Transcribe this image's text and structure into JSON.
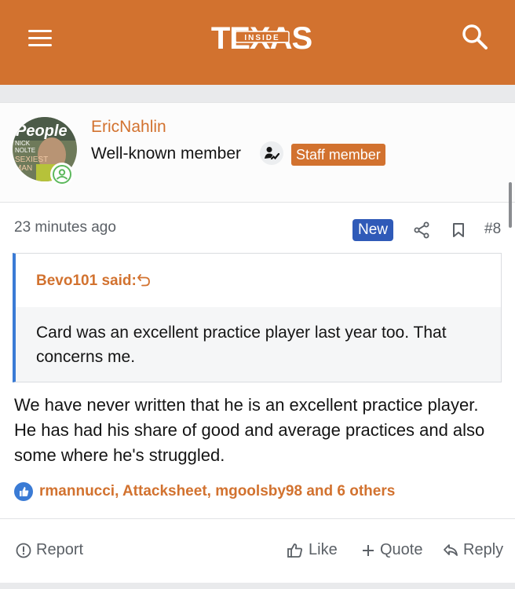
{
  "header": {
    "logo_main": "TEXAS",
    "logo_inner": "INSIDE",
    "bg_color": "#d2722f"
  },
  "author": {
    "name": "EricNahlin",
    "title": "Well-known member",
    "staff_badge": "Staff member",
    "avatar_text": {
      "brand": "People",
      "line1": "NICK",
      "line2": "NOLTE",
      "line3": "SEXIEST",
      "line4": "MAN"
    }
  },
  "post": {
    "time": "23 minutes ago",
    "new_badge": "New",
    "number": "#8",
    "quote": {
      "author": "Bevo101 said:",
      "text": "Card was an excellent practice player last year too. That concerns me."
    },
    "body": "We have never written that he is an excellent practice player. He has had his share of good and average practices and also some where he's struggled.",
    "likers": "rmannucci, Attacksheet, mgoolsby98 and 6 others"
  },
  "actions": {
    "report": "Report",
    "like": "Like",
    "quote": "Quote",
    "reply": "Reply"
  },
  "colors": {
    "accent": "#d2722f",
    "new_badge": "#2f5ab8",
    "quote_border": "#3a7bd5"
  }
}
